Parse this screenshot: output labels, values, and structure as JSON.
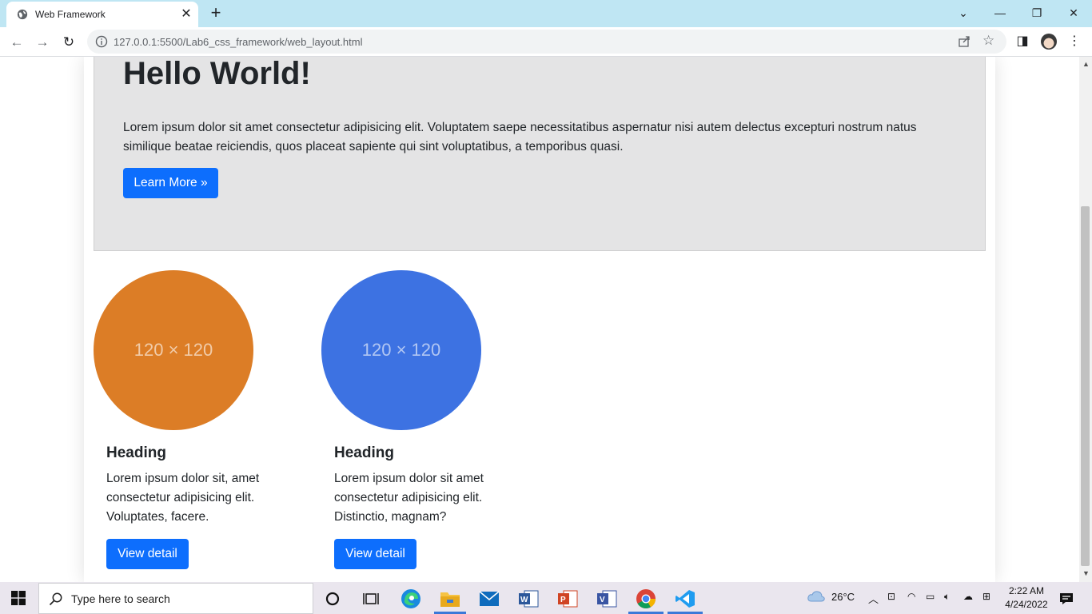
{
  "browser": {
    "tab_title": "Web Framework",
    "url": "127.0.0.1:5500/Lab6_css_framework/web_layout.html"
  },
  "page": {
    "jumbotron": {
      "title": "Hello World!",
      "text": "Lorem ipsum dolor sit amet consectetur adipisicing elit. Voluptatem saepe necessitatibus aspernatur nisi autem delectus excepturi nostrum natus similique beatae reiciendis, quos placeat sapiente qui sint voluptatibus, a temporibus quasi.",
      "button": "Learn More »"
    },
    "cards": [
      {
        "image_label": "120 × 120",
        "image_color": "#dc7d26",
        "heading": "Heading",
        "text": "Lorem ipsum dolor sit, amet consectetur adipisicing elit. Voluptates, facere.",
        "button": "View detail"
      },
      {
        "image_label": "120 × 120",
        "image_color": "#3d72e2",
        "heading": "Heading",
        "text": "Lorem ipsum dolor sit amet consectetur adipisicing elit. Distinctio, magnam?",
        "button": "View detail"
      }
    ]
  },
  "taskbar": {
    "search_placeholder": "Type here to search",
    "weather": "26°C",
    "time": "2:22 AM",
    "date": "4/24/2022"
  },
  "colors": {
    "primary": "#0d6efd",
    "jumbotron_bg": "#e4e4e5",
    "tab_strip": "#bfe6f3"
  }
}
